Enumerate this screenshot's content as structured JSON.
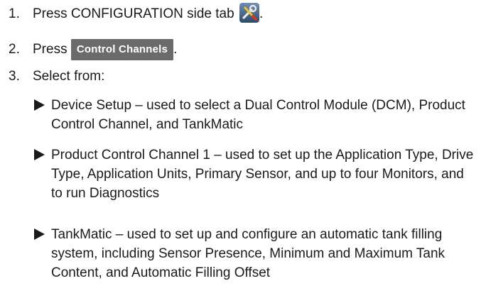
{
  "steps": [
    {
      "number": "1.",
      "text_before": "Press CONFIGURATION side tab",
      "icon": "wrench-screwdriver-icon",
      "text_after": "."
    },
    {
      "number": "2.",
      "text_before": "Press",
      "button_label": "Control Channels",
      "text_after": "."
    },
    {
      "number": "3.",
      "text": "Select from:"
    }
  ],
  "options": [
    "Device Setup – used to select a Dual Control Module (DCM), Product Control Channel, and TankMatic",
    "Product Control Channel 1 – used to set up the Application Type, Drive Type, Application Units, Primary Sensor, and up to four Monitors, and to run Diagnostics",
    "TankMatic – used to set up and configure an automatic tank filling system, including Sensor Presence, Minimum and Maximum Tank Content, and Automatic Filling Offset"
  ],
  "colors": {
    "button_bg": "#6b6b6b",
    "icon_bg": "#3e5b7a"
  }
}
